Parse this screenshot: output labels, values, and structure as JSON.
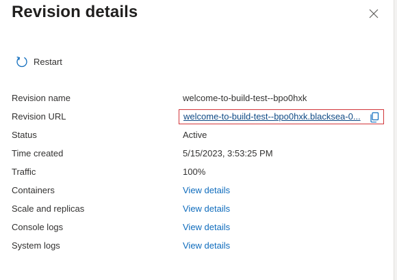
{
  "panel": {
    "title": "Revision details"
  },
  "toolbar": {
    "restart_label": "Restart"
  },
  "details": {
    "revision_name": {
      "label": "Revision name",
      "value": "welcome-to-build-test--bpo0hxk"
    },
    "revision_url": {
      "label": "Revision URL",
      "value": "welcome-to-build-test--bpo0hxk.blacksea-0..."
    },
    "status": {
      "label": "Status",
      "value": "Active"
    },
    "time_created": {
      "label": "Time created",
      "value": "5/15/2023, 3:53:25 PM"
    },
    "traffic": {
      "label": "Traffic",
      "value": "100%"
    },
    "containers": {
      "label": "Containers",
      "value": "View details"
    },
    "scale_and_replicas": {
      "label": "Scale and replicas",
      "value": "View details"
    },
    "console_logs": {
      "label": "Console logs",
      "value": "View details"
    },
    "system_logs": {
      "label": "System logs",
      "value": "View details"
    }
  },
  "icons": {
    "close": "close-icon",
    "restart": "restart-icon",
    "copy": "copy-icon"
  },
  "colors": {
    "link": "#0f6cbd",
    "highlight_border": "#d13438",
    "icon_accent": "#0f6cbd"
  }
}
